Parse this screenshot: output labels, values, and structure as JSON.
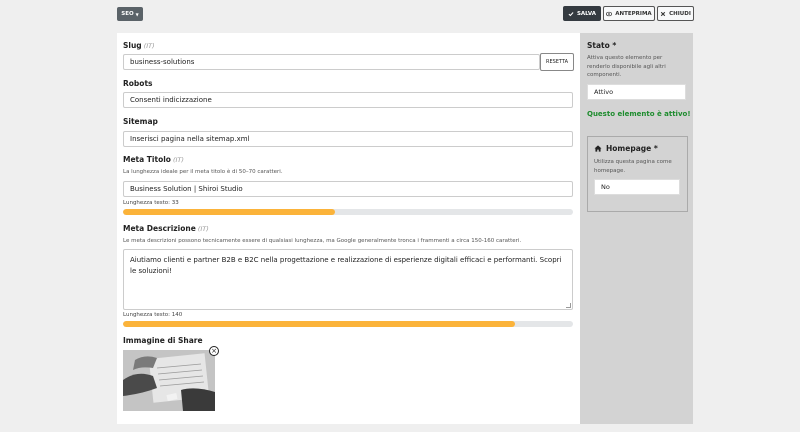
{
  "toolbar": {
    "seo_label": "SEO",
    "save_label": "SALVA",
    "preview_label": "ANTEPRIMA",
    "close_label": "CHIUDI"
  },
  "slug": {
    "label": "Slug",
    "lang": "(IT)",
    "value": "business-solutions",
    "reset_label": "RESETTA"
  },
  "robots": {
    "label": "Robots",
    "value": "Consenti indicizzazione"
  },
  "sitemap": {
    "label": "Sitemap",
    "value": "Inserisci pagina nella sitemap.xml"
  },
  "meta_title": {
    "label": "Meta Titolo",
    "lang": "(IT)",
    "help": "La lunghezza ideale per il meta titolo è di 50–70 caratteri.",
    "value": "Business Solution | Shiroi Studio",
    "counter": "Lunghezza testo: 33",
    "progress_fraction": 0.47
  },
  "meta_description": {
    "label": "Meta Descrizione",
    "lang": "(IT)",
    "help": "Le meta descrizioni possono tecnicamente essere di qualsiasi lunghezza, ma Google generalmente tronca i frammenti a circa 150-160 caratteri.",
    "value": "Aiutiamo clienti e partner B2B e B2C nella progettazione e realizzazione di esperienze digitali efficaci e performanti. Scopri le soluzioni!",
    "counter": "Lunghezza testo: 140",
    "progress_fraction": 0.87
  },
  "share_image": {
    "label": "Immagine di Share"
  },
  "side": {
    "status_label": "Stato *",
    "status_help": "Attiva questo elemento per renderlo disponibile agli altri componenti.",
    "status_value": "Attivo",
    "status_message": "Questo elemento è attivo!",
    "homepage_label": "Homepage *",
    "homepage_help": "Utilizza questa pagina come homepage.",
    "homepage_value": "No"
  },
  "colors": {
    "progress": "#fbb33a",
    "success": "#1e8c2e",
    "primary_button": "#343a40"
  },
  "icons": {
    "save": "check-icon",
    "preview": "eye-icon",
    "close": "close-icon",
    "homepage": "home-icon",
    "remove_image": "close-circle-icon"
  }
}
